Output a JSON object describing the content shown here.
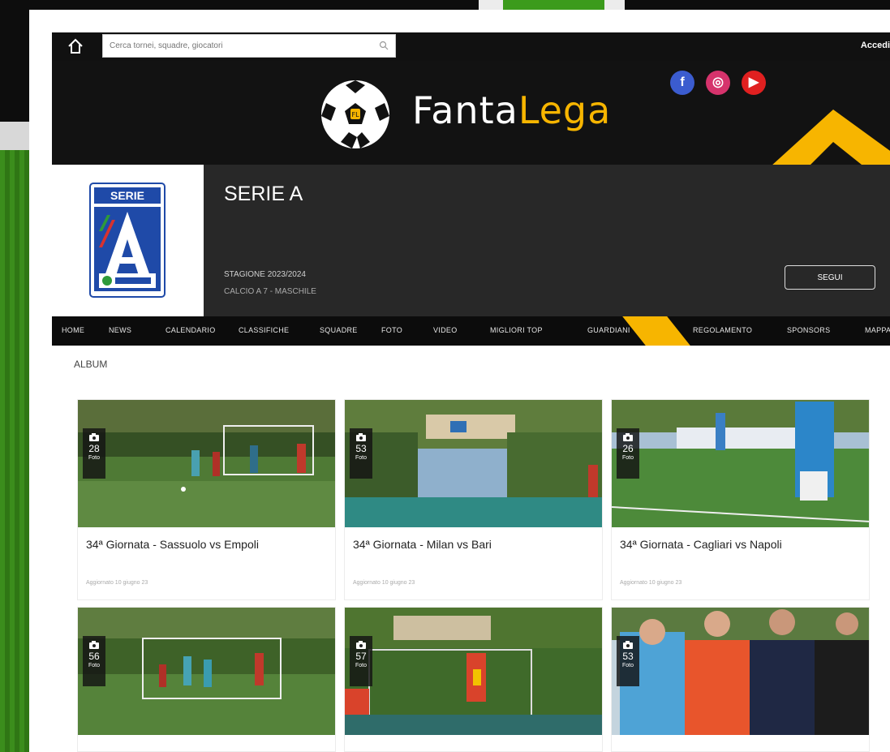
{
  "topbar": {
    "search_placeholder": "Cerca tornei, squadre, giocatori",
    "login_label": "Accedi"
  },
  "brand": {
    "name_part1": "Fanta",
    "name_part2": "Lega",
    "ball_letter": "FL",
    "accent_color": "#f7b500"
  },
  "social": [
    {
      "icon": "facebook-icon",
      "glyph": "f",
      "color": "#3b5ccf"
    },
    {
      "icon": "instagram-icon",
      "glyph": "◎",
      "color": "#d6336c"
    },
    {
      "icon": "youtube-icon",
      "glyph": "▶",
      "color": "#e02020"
    }
  ],
  "league": {
    "badge_text": "SERIE",
    "title": "SERIE A",
    "season": "STAGIONE 2023/2024",
    "subtitle": "CALCIO A 7 - MASCHILE",
    "follow_label": "SEGUI"
  },
  "nav": {
    "items": [
      "HOME",
      "NEWS",
      "CALENDARIO",
      "CLASSIFICHE",
      "SQUADRE",
      "FOTO",
      "VIDEO",
      "MIGLIORI TOP",
      "GUARDIANI",
      "REGOLAMENTO",
      "SPONSORS",
      "MAPPA"
    ]
  },
  "section_title": "ALBUM",
  "albums": [
    {
      "count": "28",
      "unit": "Foto",
      "title": "34ª Giornata - Sassuolo vs Empoli",
      "meta": "Aggiornato 10 giugno 23"
    },
    {
      "count": "53",
      "unit": "Foto",
      "title": "34ª Giornata - Milan vs Bari",
      "meta": "Aggiornato 10 giugno 23"
    },
    {
      "count": "26",
      "unit": "Foto",
      "title": "34ª Giornata - Cagliari vs Napoli",
      "meta": "Aggiornato 10 giugno 23"
    },
    {
      "count": "56",
      "unit": "Foto",
      "title": "",
      "meta": ""
    },
    {
      "count": "57",
      "unit": "Foto",
      "title": "",
      "meta": ""
    },
    {
      "count": "53",
      "unit": "Foto",
      "title": "",
      "meta": ""
    }
  ]
}
